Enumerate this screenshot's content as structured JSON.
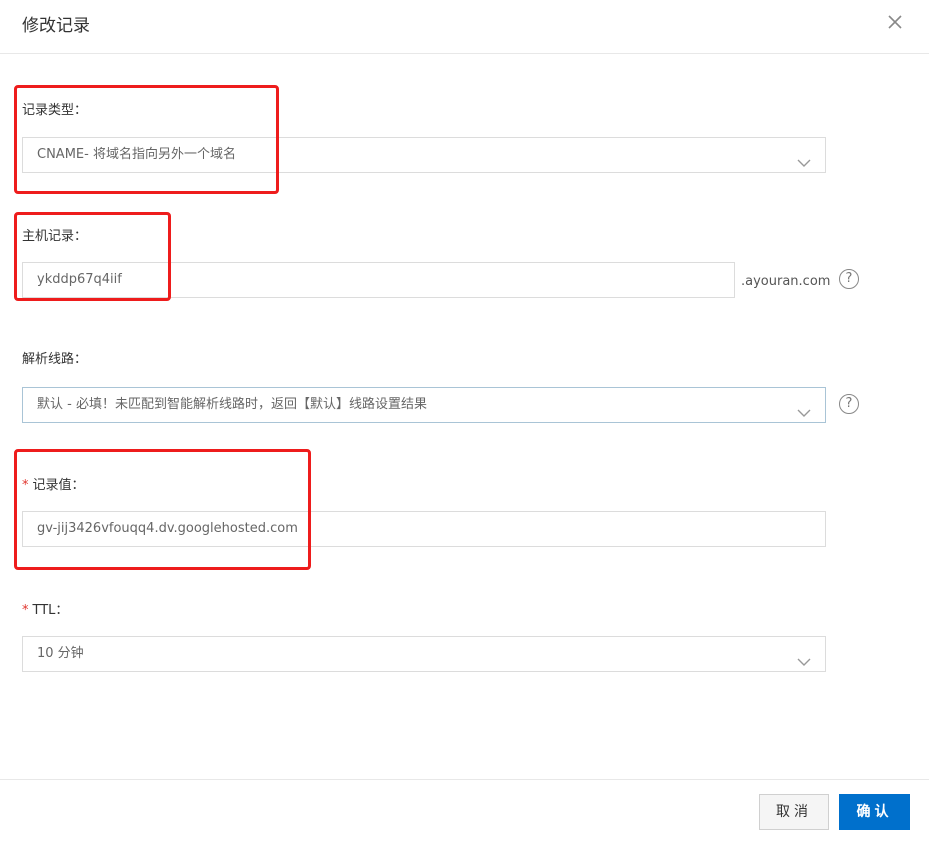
{
  "dialog": {
    "title": "修改记录",
    "close_icon": "close-icon"
  },
  "record_type": {
    "label": "记录类型：",
    "value": "CNAME- 将域名指向另外一个域名"
  },
  "host_record": {
    "label": "主机记录：",
    "value": "ykddp67q4iif",
    "suffix": ".ayouran.com",
    "help": "?"
  },
  "resolve_line": {
    "label": "解析线路：",
    "value": "默认 - 必填！未匹配到智能解析线路时，返回【默认】线路设置结果",
    "help": "?"
  },
  "record_value": {
    "required_mark": "*",
    "label": "记录值：",
    "value": "gv-jij3426vfouqq4.dv.googlehosted.com"
  },
  "ttl": {
    "required_mark": "*",
    "label": "TTL：",
    "value": "10 分钟"
  },
  "footer": {
    "cancel_label": "取消",
    "ok_label": "确认"
  },
  "colors": {
    "primary": "#0070cc",
    "highlight": "#ee1c1c",
    "required": "#e0342c"
  }
}
